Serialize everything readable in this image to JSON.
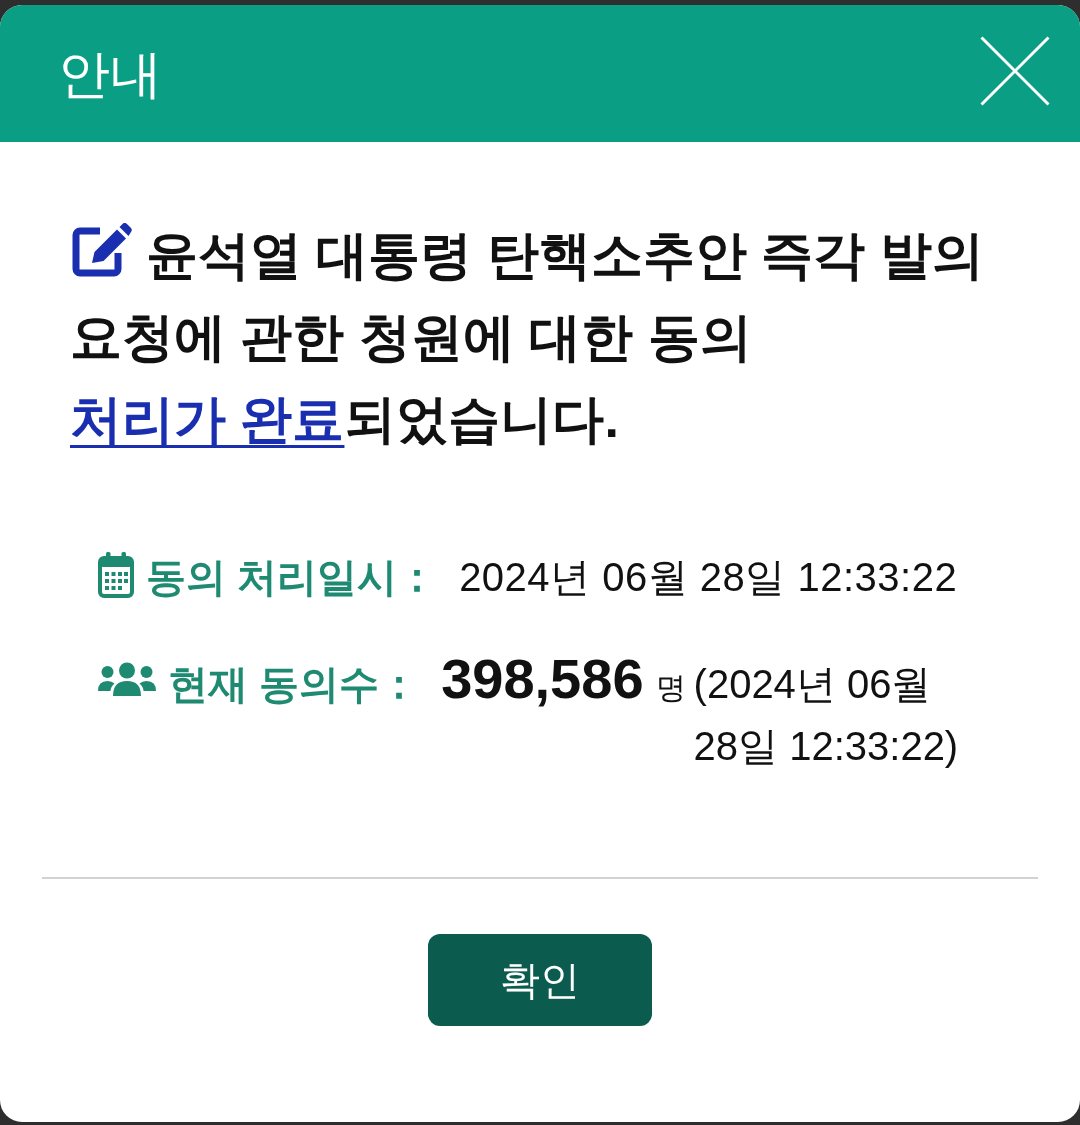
{
  "dialog": {
    "title": "안내"
  },
  "message": {
    "text": "윤석열 대통령 탄핵소추안 즉각 발의 요청에 관한 청원에 대한 동의 ",
    "link": "처리가 완료",
    "text_end": "되었습니다."
  },
  "details": [
    {
      "kind": "date",
      "label": "동의 처리일시：",
      "value": "2024년 06월 28일 12:33:22"
    },
    {
      "kind": "count",
      "label": "현재 동의수：",
      "count": "398,586",
      "unit": "명",
      "note": "(2024년 06월 28일 12:33:22)"
    }
  ],
  "buttons": [
    {
      "label": "확인"
    }
  ]
}
